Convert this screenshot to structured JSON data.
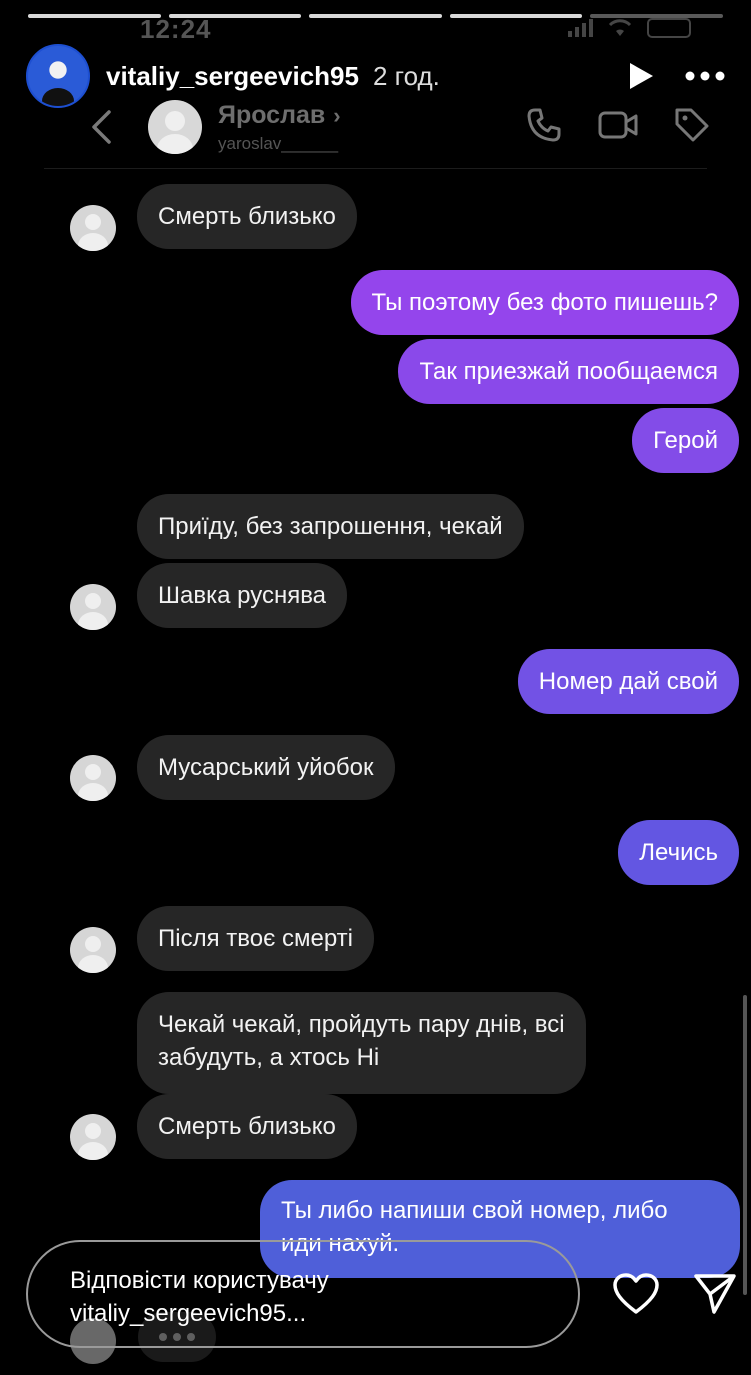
{
  "status_bar": {
    "time": "12:24"
  },
  "story": {
    "username": "vitaliy_sergeevich95",
    "time_ago": "2 год.",
    "progress_segments": 5,
    "progress_active": 4
  },
  "chat_header": {
    "contact_name": "Ярослав",
    "contact_handle": "yaroslav______",
    "icons": [
      "back-icon",
      "phone-icon",
      "video-icon",
      "tag-icon"
    ]
  },
  "messages": [
    {
      "dir": "in",
      "text": "Смерть близько",
      "avatar": true
    },
    {
      "dir": "out",
      "text": "Ты поэтому без фото пишешь?"
    },
    {
      "dir": "out",
      "text": "Так приезжай пообщаемся"
    },
    {
      "dir": "out",
      "text": "Герой"
    },
    {
      "dir": "in",
      "text": "Приїду, без запрошення, чекай",
      "avatar": false
    },
    {
      "dir": "in",
      "text": "Шавка руснява",
      "avatar": true
    },
    {
      "dir": "out",
      "text": "Номер дай свой"
    },
    {
      "dir": "in",
      "text": "Мусарський уйобок",
      "avatar": true
    },
    {
      "dir": "out",
      "text": "Лечись"
    },
    {
      "dir": "in",
      "text": "Після твоє смерті",
      "avatar": true
    },
    {
      "dir": "in",
      "lines": [
        "Чекай чекай, пройдуть пару днів, всі",
        "забудуть, а хтось Ні"
      ],
      "avatar": false
    },
    {
      "dir": "in",
      "text": "Смерть близько",
      "avatar": true
    },
    {
      "dir": "out",
      "lines": [
        "Ты либо напиши свой номер, либо",
        "иди нахуй."
      ]
    }
  ],
  "reply": {
    "placeholder_line1": "Відповісти користувачу",
    "placeholder_line2": "vitaliy_sergeevich95..."
  },
  "colors": {
    "background": "#000000",
    "incoming_bubble": "#262626",
    "outgoing_top": "#9b45ee",
    "outgoing_bottom": "#4f5fd9"
  }
}
